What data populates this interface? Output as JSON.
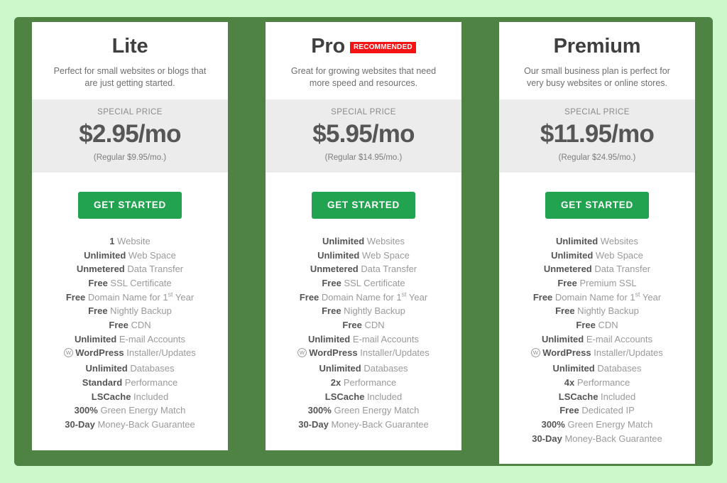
{
  "theme": {
    "page_background": "#ccf8cb",
    "container_background": "#4e8344",
    "card_background": "#ffffff",
    "price_band_background": "#ececec",
    "cta_color": "#22a34f",
    "badge_color": "#f51313"
  },
  "plans": [
    {
      "name": "Lite",
      "badge": null,
      "description": "Perfect for small websites or blogs that are just getting started.",
      "price_label": "SPECIAL PRICE",
      "price": "$2.95/mo",
      "regular_price": "(Regular $9.95/mo.)",
      "cta_label": "GET STARTED",
      "features": [
        {
          "strong": "1",
          "rest": " Website"
        },
        {
          "strong": "Unlimited",
          "rest": " Web Space"
        },
        {
          "strong": "Unmetered",
          "rest": " Data Transfer"
        },
        {
          "strong": "Free",
          "rest": " SSL Certificate"
        },
        {
          "strong": "Free",
          "rest": " Domain Name for 1st Year",
          "sup": "st"
        },
        {
          "strong": "Free",
          "rest": " Nightly Backup"
        },
        {
          "strong": "Free",
          "rest": " CDN"
        },
        {
          "strong": "Unlimited",
          "rest": " E-mail Accounts"
        },
        {
          "strong": "WordPress",
          "rest": " Installer/Updates",
          "icon": "wordpress-icon"
        },
        {
          "strong": "Unlimited",
          "rest": " Databases"
        },
        {
          "strong": "Standard",
          "rest": " Performance"
        },
        {
          "strong": "LSCache",
          "rest": " Included"
        },
        {
          "strong": "300%",
          "rest": " Green Energy Match"
        },
        {
          "strong": "30-Day",
          "rest": " Money-Back Guarantee"
        }
      ]
    },
    {
      "name": "Pro",
      "badge": "RECOMMENDED",
      "description": "Great for growing websites that need more speed and resources.",
      "price_label": "SPECIAL PRICE",
      "price": "$5.95/mo",
      "regular_price": "(Regular $14.95/mo.)",
      "cta_label": "GET STARTED",
      "features": [
        {
          "strong": "Unlimited",
          "rest": " Websites"
        },
        {
          "strong": "Unlimited",
          "rest": " Web Space"
        },
        {
          "strong": "Unmetered",
          "rest": " Data Transfer"
        },
        {
          "strong": "Free",
          "rest": " SSL Certificate"
        },
        {
          "strong": "Free",
          "rest": " Domain Name for 1st Year",
          "sup": "st"
        },
        {
          "strong": "Free",
          "rest": " Nightly Backup"
        },
        {
          "strong": "Free",
          "rest": " CDN"
        },
        {
          "strong": "Unlimited",
          "rest": " E-mail Accounts"
        },
        {
          "strong": "WordPress",
          "rest": " Installer/Updates",
          "icon": "wordpress-icon"
        },
        {
          "strong": "Unlimited",
          "rest": " Databases"
        },
        {
          "strong": "2x",
          "rest": " Performance"
        },
        {
          "strong": "LSCache",
          "rest": " Included"
        },
        {
          "strong": "300%",
          "rest": " Green Energy Match"
        },
        {
          "strong": "30-Day",
          "rest": " Money-Back Guarantee"
        }
      ]
    },
    {
      "name": "Premium",
      "badge": null,
      "description": "Our small business plan is perfect for very busy websites or online stores.",
      "price_label": "SPECIAL PRICE",
      "price": "$11.95/mo",
      "regular_price": "(Regular $24.95/mo.)",
      "cta_label": "GET STARTED",
      "features": [
        {
          "strong": "Unlimited",
          "rest": " Websites"
        },
        {
          "strong": "Unlimited",
          "rest": " Web Space"
        },
        {
          "strong": "Unmetered",
          "rest": " Data Transfer"
        },
        {
          "strong": "Free",
          "rest": " Premium SSL"
        },
        {
          "strong": "Free",
          "rest": " Domain Name for 1st Year",
          "sup": "st"
        },
        {
          "strong": "Free",
          "rest": " Nightly Backup"
        },
        {
          "strong": "Free",
          "rest": " CDN"
        },
        {
          "strong": "Unlimited",
          "rest": " E-mail Accounts"
        },
        {
          "strong": "WordPress",
          "rest": " Installer/Updates",
          "icon": "wordpress-icon"
        },
        {
          "strong": "Unlimited",
          "rest": " Databases"
        },
        {
          "strong": "4x",
          "rest": " Performance"
        },
        {
          "strong": "LSCache",
          "rest": " Included"
        },
        {
          "strong": "Free",
          "rest": " Dedicated IP"
        },
        {
          "strong": "300%",
          "rest": " Green Energy Match"
        },
        {
          "strong": "30-Day",
          "rest": " Money-Back Guarantee"
        }
      ]
    }
  ]
}
